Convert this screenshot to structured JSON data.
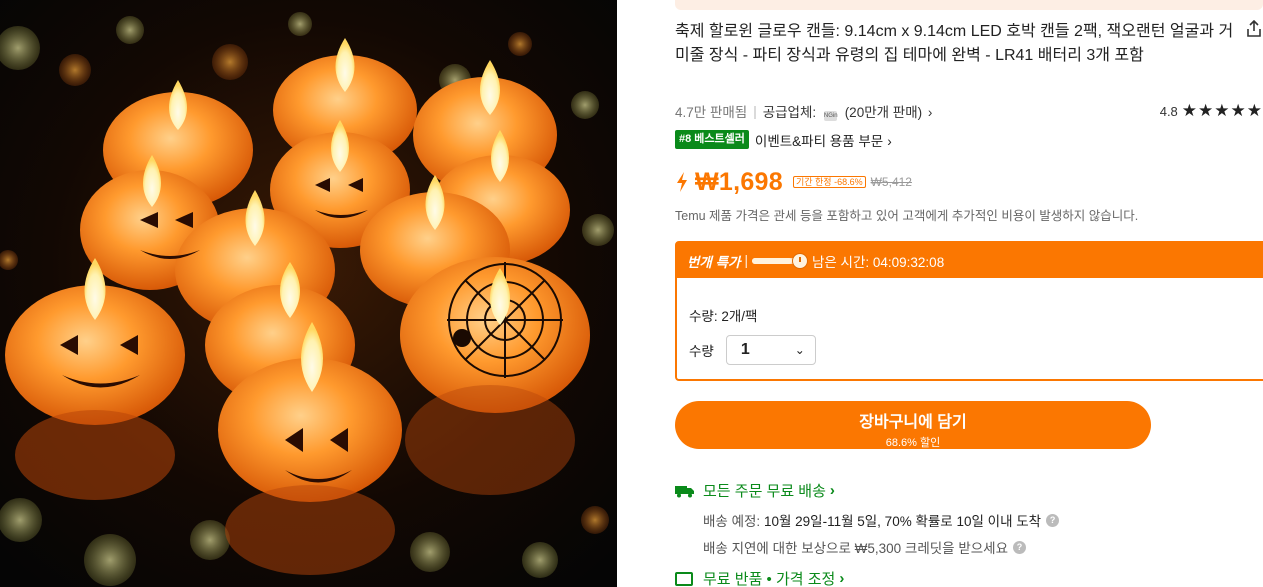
{
  "product": {
    "title": "축제 할로윈 글로우 캔들: 9.14cm x 9.14cm LED 호박 캔들 2팩, 잭오랜턴 얼굴과 거미줄 장식 - 파티 장식과 유령의 집 테마에 완벽 - LR41 배터리 3개 포함",
    "sold": "4.7만 판매됨",
    "supplier_label": "공급업체:",
    "supplier_logo": "NGin",
    "supplier_sales": "(20만개 판매)",
    "rating": "4.8",
    "stars": "★★★★★",
    "best_badge": "#8 베스트셀러",
    "best_category": "이벤트&파티 용품 부문",
    "price": "₩1,698",
    "price_tag": "기간 한정 -68.6%",
    "original_price": "₩5,412",
    "tax_note": "Temu 제품 가격은 관세 등을 포함하고 있어 고객에게 추가적인 비용이 발생하지 않습니다."
  },
  "flash": {
    "label": "번개 특가",
    "pipe": "|",
    "progress": 0.75,
    "remaining": "남은 시간: 04:09:32:08"
  },
  "options": {
    "pack_text": "수량: 2개/팩",
    "qty_label": "수량",
    "qty_value": "1"
  },
  "cart": {
    "label": "장바구니에 담기",
    "discount": "68.6% 할인"
  },
  "shipping": {
    "title": "모든 주문 무료 배송",
    "eta_label": "배송 예정:",
    "eta_value": "10월 29일-11월 5일, 70% 확률로 10일 이내 도착",
    "delay_note": "배송 지연에 대한 보상으로 ₩5,300 크레딧을 받으세요",
    "returns": "무료 반품 • 가격 조정"
  },
  "icons": {
    "share": "share-icon",
    "flash": "lightning-icon",
    "truck": "truck-icon",
    "help": "question-icon",
    "return": "return-icon"
  },
  "colors": {
    "accent": "#fb7701",
    "green": "#0a8a1a"
  }
}
